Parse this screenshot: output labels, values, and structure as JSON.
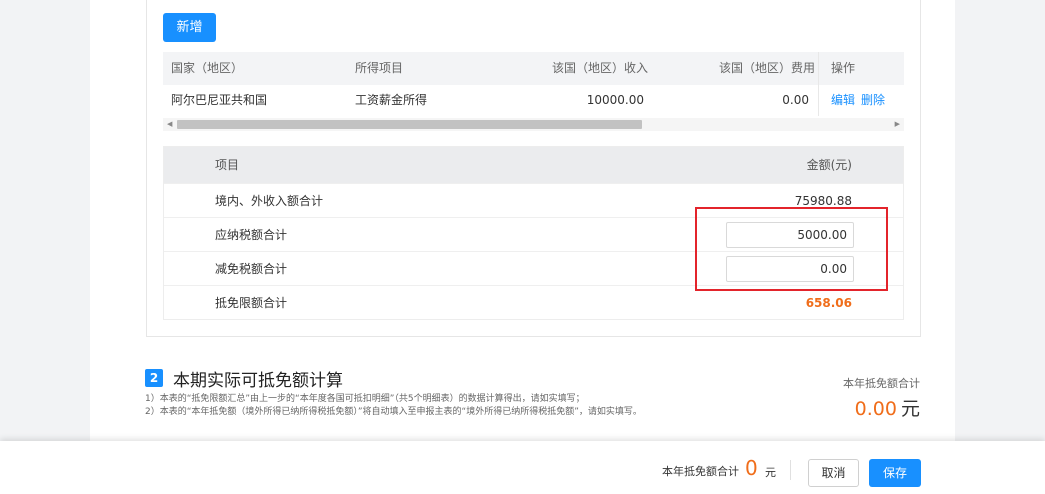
{
  "section1": {
    "add_button": "新增",
    "country_table": {
      "headers": [
        "国家（地区）",
        "所得项目",
        "该国（地区）收入",
        "该国（地区）费用",
        "操作"
      ],
      "rows": [
        {
          "country": "阿尔巴尼亚共和国",
          "item": "工资薪金所得",
          "income": "10000.00",
          "expense": "0.00",
          "edit": "编辑",
          "delete": "删除"
        }
      ]
    },
    "summary_table": {
      "header_label": "项目",
      "header_value": "金额(元)",
      "rows": [
        {
          "label": "境内、外收入额合计",
          "value": "75980.88"
        },
        {
          "label": "应纳税额合计",
          "value": "5000.00"
        },
        {
          "label": "减免税额合计",
          "value": "0.00"
        },
        {
          "label": "抵免限额合计",
          "value": "658.06"
        }
      ]
    }
  },
  "section2": {
    "number": "2",
    "title": "本期实际可抵免额计算",
    "notes": [
      "1）本表的“抵免限额汇总”由上一步的“本年度各国可抵扣明细”（共5个明细表）的数据计算得出，请如实填写；",
      "2）本表的“本年抵免额（境外所得已纳所得税抵免额）”将自动填入至申报主表的“境外所得已纳所得税抵免额”，请如实填写。"
    ],
    "total_label": "本年抵免额合计",
    "total_value": "0.00",
    "total_unit": "元"
  },
  "footer": {
    "total_label": "本年抵免额合计",
    "total_value": "0",
    "total_unit": "元",
    "cancel": "取消",
    "save": "保存"
  },
  "colors": {
    "primary": "#1890ff",
    "accent_orange": "#f06d1a",
    "highlight_red": "#e3242b"
  }
}
